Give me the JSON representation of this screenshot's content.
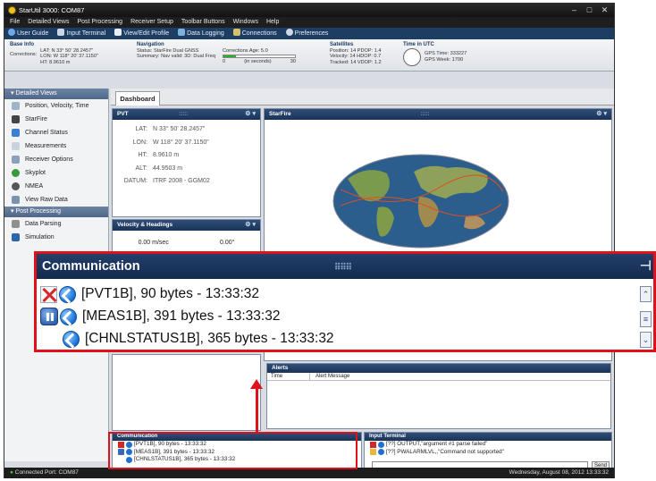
{
  "window": {
    "title": "StarUtil 3000: COM87"
  },
  "menubar": {
    "items": [
      "File",
      "Detailed Views",
      "Post Processing",
      "Receiver Setup",
      "Toolbar Buttons",
      "Windows",
      "Help"
    ]
  },
  "toolbar": {
    "items": [
      {
        "label": "User Guide",
        "icon": "help-icon"
      },
      {
        "label": "Input Terminal",
        "icon": "terminal-icon"
      },
      {
        "label": "View/Edit Profile",
        "icon": "profile-icon"
      },
      {
        "label": "Data Logging",
        "icon": "data-logging-icon"
      },
      {
        "label": "Connections",
        "icon": "connections-icon"
      },
      {
        "label": "Preferences",
        "icon": "gear-icon"
      }
    ]
  },
  "infobar": {
    "base": {
      "title": "Base Info",
      "conn_label": "Corrections:",
      "lat": "LAT: N 33° 50' 28.2457\"",
      "lon": "LON: W 118° 20' 37.1150\"",
      "ht": "HT: 8.9610 m"
    },
    "nav": {
      "title": "Navigation",
      "status": "Status:",
      "status_value": "StarFire Dual GNSS",
      "summary": "Summary:",
      "summary_value": "Nav valid: 3D: Dual Freq",
      "age": "Corrections Age: 5.0",
      "age_min": "0",
      "age_unit": "(in seconds)",
      "age_max": "30",
      "age_fill": 0.17
    },
    "sats": {
      "title": "Satellites",
      "line1": "Position: 14   PDOP: 1.4",
      "line2": "Velocity: 14   HDOP: 0.7",
      "line3": "Tracked: 14   VDOP: 1.2"
    },
    "time": {
      "title": "Time in UTC",
      "gps_time": "GPS Time: 333227",
      "gps_week": "GPS Week: 1700"
    }
  },
  "sidebar": {
    "sections": [
      {
        "title": "Detailed Views",
        "items": [
          "Position, Velocity, Time",
          "StarFire",
          "Channel Status",
          "Measurements",
          "Receiver Options",
          "Skyplot",
          "NMEA",
          "View Raw Data"
        ]
      },
      {
        "title": "Post Processing",
        "items": [
          "Data Parsing",
          "Simulation"
        ]
      }
    ]
  },
  "tabs": {
    "dashboard": "Dashboard"
  },
  "pvt": {
    "title": "PVT",
    "rows": [
      {
        "key": "LAT:",
        "value": "N 33° 50' 28.2457\""
      },
      {
        "key": "LON:",
        "value": "W 118° 20' 37.1150\""
      },
      {
        "key": "HT:",
        "value": "8.9610 m"
      },
      {
        "key": "ALT:",
        "value": "44.9503 m"
      },
      {
        "key": "DATUM:",
        "value": "ITRF 2008 - GGM02"
      }
    ]
  },
  "starfire": {
    "title": "StarFire"
  },
  "velocity": {
    "title": "Velocity & Headings",
    "speed": "0.00 m/sec",
    "heading": "0.00°"
  },
  "alerts": {
    "title": "Alerts",
    "col_time": "Time",
    "col_msg": "Alert Message"
  },
  "communication": {
    "title": "Communication",
    "messages": [
      "[PVT1B], 90 bytes - 13:33:32",
      "[MEAS1B], 391 bytes - 13:33:32",
      "[CHNLSTATUS1B], 365 bytes - 13:33:32"
    ]
  },
  "input_terminal": {
    "title": "Input Terminal",
    "lines": [
      "[??] OUTPUT,\"argument #1 parse failed\"",
      "[??] PWALARMLVL,,\"Command not supported\""
    ],
    "send": "Send"
  },
  "statusbar": {
    "left": "Connected Port: COM87",
    "right": "Wednesday, August 08, 2012 13:33:32"
  },
  "colors": {
    "accent": "#1e3d63",
    "highlight": "#e0111a"
  }
}
